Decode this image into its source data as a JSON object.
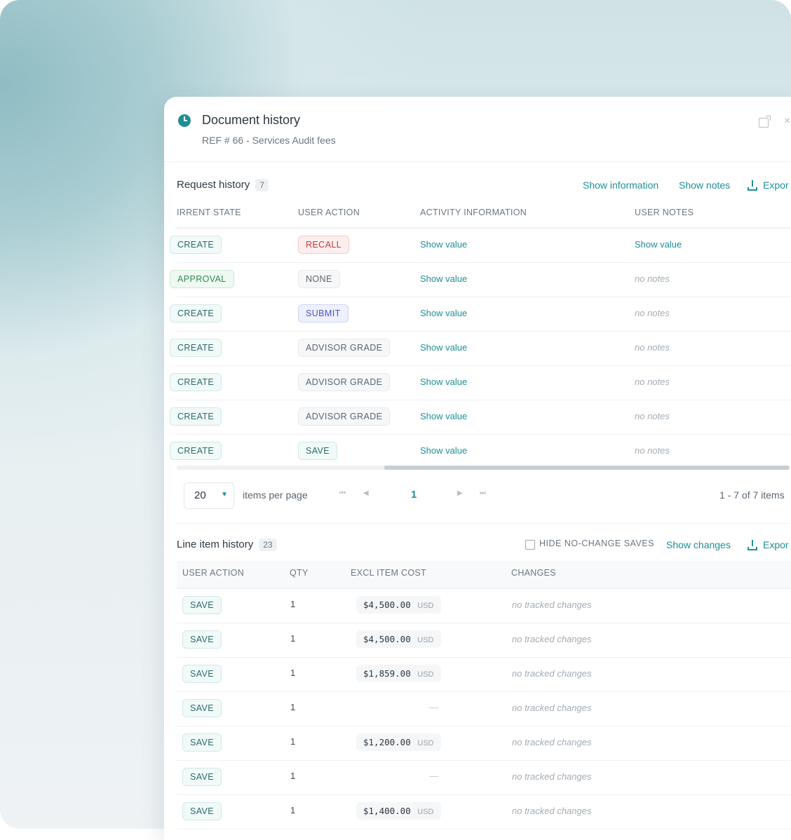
{
  "header": {
    "title": "Document history",
    "subtitle": "REF # 66 - Services Audit fees",
    "close_glyph": "×"
  },
  "request_history": {
    "title": "Request history",
    "count": "7",
    "show_information": "Show information",
    "show_notes": "Show notes",
    "export": "Expor",
    "columns": [
      "IRRENT STATE",
      "USER ACTION",
      "ACTIVITY INFORMATION",
      "USER NOTES"
    ],
    "rows": [
      {
        "state": "CREATE",
        "action": "RECALL",
        "info": "Show value",
        "notes": "Show value"
      },
      {
        "state": "APPROVAL",
        "action": "NONE",
        "info": "Show value",
        "notes": "no notes"
      },
      {
        "state": "CREATE",
        "action": "SUBMIT",
        "info": "Show value",
        "notes": "no notes"
      },
      {
        "state": "CREATE",
        "action": "ADVISOR GRADE",
        "info": "Show value",
        "notes": "no notes"
      },
      {
        "state": "CREATE",
        "action": "ADVISOR GRADE",
        "info": "Show value",
        "notes": "no notes"
      },
      {
        "state": "CREATE",
        "action": "ADVISOR GRADE",
        "info": "Show value",
        "notes": "no notes"
      },
      {
        "state": "CREATE",
        "action": "SAVE",
        "info": "Show value",
        "notes": "no notes"
      }
    ],
    "pager": {
      "page_size": "20",
      "items_per_page": "items per page",
      "current_page": "1",
      "range": "1 - 7 of 7 items"
    }
  },
  "line_item_history": {
    "title": "Line item history",
    "count": "23",
    "hide_label": "HIDE NO-CHANGE SAVES",
    "show_changes": "Show changes",
    "export": "Expor",
    "columns": [
      "USER ACTION",
      "QTY",
      "EXCL ITEM COST",
      "CHANGES"
    ],
    "rows": [
      {
        "action": "SAVE",
        "qty": "1",
        "cost": "$4,500.00",
        "currency": "USD",
        "changes": "no tracked changes"
      },
      {
        "action": "SAVE",
        "qty": "1",
        "cost": "$4,500.00",
        "currency": "USD",
        "changes": "no tracked changes"
      },
      {
        "action": "SAVE",
        "qty": "1",
        "cost": "$1,859.00",
        "currency": "USD",
        "changes": "no tracked changes"
      },
      {
        "action": "SAVE",
        "qty": "1",
        "cost": "—",
        "currency": "",
        "changes": "no tracked changes"
      },
      {
        "action": "SAVE",
        "qty": "1",
        "cost": "$1,200.00",
        "currency": "USD",
        "changes": "no tracked changes"
      },
      {
        "action": "SAVE",
        "qty": "1",
        "cost": "—",
        "currency": "",
        "changes": "no tracked changes"
      },
      {
        "action": "SAVE",
        "qty": "1",
        "cost": "$1,400.00",
        "currency": "USD",
        "changes": "no tracked changes"
      }
    ]
  },
  "colors": {
    "accent": "#1f8f95",
    "recall": "#c33a3a",
    "submit": "#4a53c2",
    "approval": "#2f8a4c"
  }
}
